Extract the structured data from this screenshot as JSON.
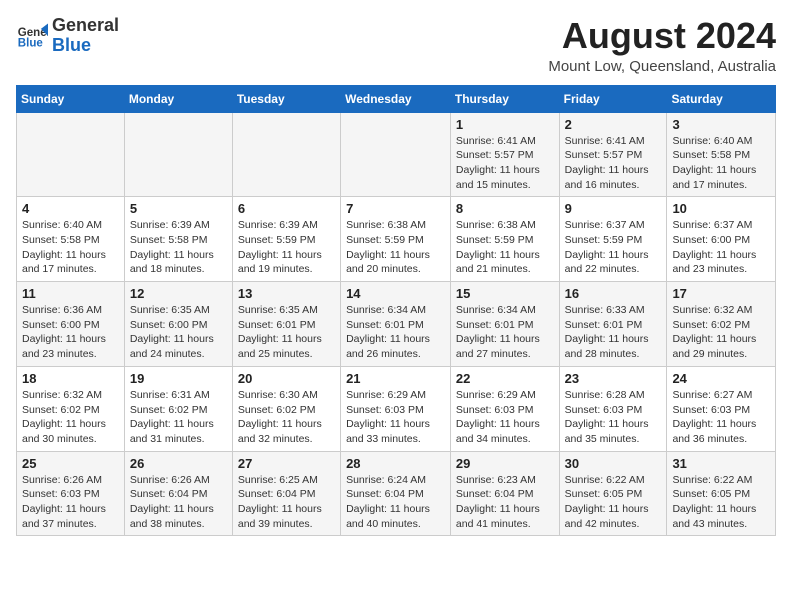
{
  "header": {
    "logo_general": "General",
    "logo_blue": "Blue",
    "title": "August 2024",
    "subtitle": "Mount Low, Queensland, Australia"
  },
  "days_of_week": [
    "Sunday",
    "Monday",
    "Tuesday",
    "Wednesday",
    "Thursday",
    "Friday",
    "Saturday"
  ],
  "weeks": [
    [
      {
        "day": "",
        "info": ""
      },
      {
        "day": "",
        "info": ""
      },
      {
        "day": "",
        "info": ""
      },
      {
        "day": "",
        "info": ""
      },
      {
        "day": "1",
        "info": "Sunrise: 6:41 AM\nSunset: 5:57 PM\nDaylight: 11 hours and 15 minutes."
      },
      {
        "day": "2",
        "info": "Sunrise: 6:41 AM\nSunset: 5:57 PM\nDaylight: 11 hours and 16 minutes."
      },
      {
        "day": "3",
        "info": "Sunrise: 6:40 AM\nSunset: 5:58 PM\nDaylight: 11 hours and 17 minutes."
      }
    ],
    [
      {
        "day": "4",
        "info": "Sunrise: 6:40 AM\nSunset: 5:58 PM\nDaylight: 11 hours and 17 minutes."
      },
      {
        "day": "5",
        "info": "Sunrise: 6:39 AM\nSunset: 5:58 PM\nDaylight: 11 hours and 18 minutes."
      },
      {
        "day": "6",
        "info": "Sunrise: 6:39 AM\nSunset: 5:59 PM\nDaylight: 11 hours and 19 minutes."
      },
      {
        "day": "7",
        "info": "Sunrise: 6:38 AM\nSunset: 5:59 PM\nDaylight: 11 hours and 20 minutes."
      },
      {
        "day": "8",
        "info": "Sunrise: 6:38 AM\nSunset: 5:59 PM\nDaylight: 11 hours and 21 minutes."
      },
      {
        "day": "9",
        "info": "Sunrise: 6:37 AM\nSunset: 5:59 PM\nDaylight: 11 hours and 22 minutes."
      },
      {
        "day": "10",
        "info": "Sunrise: 6:37 AM\nSunset: 6:00 PM\nDaylight: 11 hours and 23 minutes."
      }
    ],
    [
      {
        "day": "11",
        "info": "Sunrise: 6:36 AM\nSunset: 6:00 PM\nDaylight: 11 hours and 23 minutes."
      },
      {
        "day": "12",
        "info": "Sunrise: 6:35 AM\nSunset: 6:00 PM\nDaylight: 11 hours and 24 minutes."
      },
      {
        "day": "13",
        "info": "Sunrise: 6:35 AM\nSunset: 6:01 PM\nDaylight: 11 hours and 25 minutes."
      },
      {
        "day": "14",
        "info": "Sunrise: 6:34 AM\nSunset: 6:01 PM\nDaylight: 11 hours and 26 minutes."
      },
      {
        "day": "15",
        "info": "Sunrise: 6:34 AM\nSunset: 6:01 PM\nDaylight: 11 hours and 27 minutes."
      },
      {
        "day": "16",
        "info": "Sunrise: 6:33 AM\nSunset: 6:01 PM\nDaylight: 11 hours and 28 minutes."
      },
      {
        "day": "17",
        "info": "Sunrise: 6:32 AM\nSunset: 6:02 PM\nDaylight: 11 hours and 29 minutes."
      }
    ],
    [
      {
        "day": "18",
        "info": "Sunrise: 6:32 AM\nSunset: 6:02 PM\nDaylight: 11 hours and 30 minutes."
      },
      {
        "day": "19",
        "info": "Sunrise: 6:31 AM\nSunset: 6:02 PM\nDaylight: 11 hours and 31 minutes."
      },
      {
        "day": "20",
        "info": "Sunrise: 6:30 AM\nSunset: 6:02 PM\nDaylight: 11 hours and 32 minutes."
      },
      {
        "day": "21",
        "info": "Sunrise: 6:29 AM\nSunset: 6:03 PM\nDaylight: 11 hours and 33 minutes."
      },
      {
        "day": "22",
        "info": "Sunrise: 6:29 AM\nSunset: 6:03 PM\nDaylight: 11 hours and 34 minutes."
      },
      {
        "day": "23",
        "info": "Sunrise: 6:28 AM\nSunset: 6:03 PM\nDaylight: 11 hours and 35 minutes."
      },
      {
        "day": "24",
        "info": "Sunrise: 6:27 AM\nSunset: 6:03 PM\nDaylight: 11 hours and 36 minutes."
      }
    ],
    [
      {
        "day": "25",
        "info": "Sunrise: 6:26 AM\nSunset: 6:03 PM\nDaylight: 11 hours and 37 minutes."
      },
      {
        "day": "26",
        "info": "Sunrise: 6:26 AM\nSunset: 6:04 PM\nDaylight: 11 hours and 38 minutes."
      },
      {
        "day": "27",
        "info": "Sunrise: 6:25 AM\nSunset: 6:04 PM\nDaylight: 11 hours and 39 minutes."
      },
      {
        "day": "28",
        "info": "Sunrise: 6:24 AM\nSunset: 6:04 PM\nDaylight: 11 hours and 40 minutes."
      },
      {
        "day": "29",
        "info": "Sunrise: 6:23 AM\nSunset: 6:04 PM\nDaylight: 11 hours and 41 minutes."
      },
      {
        "day": "30",
        "info": "Sunrise: 6:22 AM\nSunset: 6:05 PM\nDaylight: 11 hours and 42 minutes."
      },
      {
        "day": "31",
        "info": "Sunrise: 6:22 AM\nSunset: 6:05 PM\nDaylight: 11 hours and 43 minutes."
      }
    ]
  ]
}
